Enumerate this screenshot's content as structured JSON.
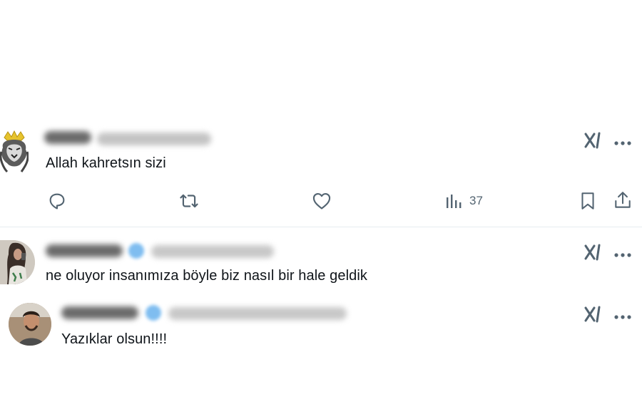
{
  "tweets": [
    {
      "text": "Allah kahretsın sizi",
      "actions": {
        "views": "37"
      }
    },
    {
      "text": "ne oluyor insanımıza böyle biz nasıl bir hale geldik"
    },
    {
      "text": "Yazıklar olsun!!!!"
    }
  ],
  "icons": {
    "reply": "reply-icon",
    "retweet": "retweet-icon",
    "like": "heart-icon",
    "views": "analytics-icon",
    "bookmark": "bookmark-icon",
    "share": "share-icon",
    "grok": "grok-icon",
    "more": "more-icon"
  },
  "colors": {
    "text": "#0f1419",
    "secondary": "#536471",
    "divider": "#e6ecf0",
    "verified": "#1d9bf0"
  }
}
